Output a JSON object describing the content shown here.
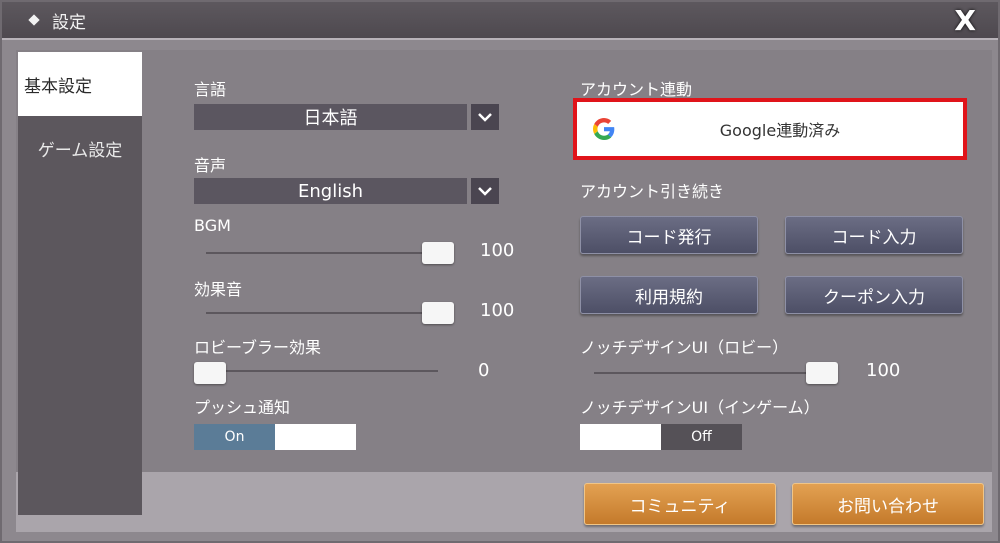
{
  "title": "設定",
  "close": "X",
  "sidebar": {
    "tabs": [
      {
        "label": "基本設定"
      },
      {
        "label": "ゲーム設定"
      }
    ]
  },
  "basic": {
    "language": {
      "label": "言語",
      "value": "日本語"
    },
    "voice": {
      "label": "音声",
      "value": "English"
    },
    "bgm": {
      "label": "BGM",
      "value": "100"
    },
    "sfx": {
      "label": "効果音",
      "value": "100"
    },
    "lobby_blur": {
      "label": "ロビーブラー効果",
      "value": "0"
    },
    "push": {
      "label": "プッシュ通知",
      "on_label": "On"
    }
  },
  "account": {
    "link_label": "アカウント連動",
    "google_label": "Google連動済み",
    "transfer_label": "アカウント引き続き",
    "buttons": {
      "code_issue": "コード発行",
      "code_input": "コード入力",
      "terms": "利用規約",
      "coupon": "クーポン入力"
    }
  },
  "notch": {
    "lobby_label": "ノッチデザインUI（ロビー）",
    "lobby_value": "100",
    "ingame_label": "ノッチデザインUI（インゲーム）",
    "ingame_off_label": "Off"
  },
  "footer": {
    "community": "コミュニティ",
    "contact": "お問い合わせ"
  },
  "colors": {
    "highlight_border": "#e0141a",
    "orange_button": "#d48c3c",
    "toggle_on": "#5b7c97"
  }
}
